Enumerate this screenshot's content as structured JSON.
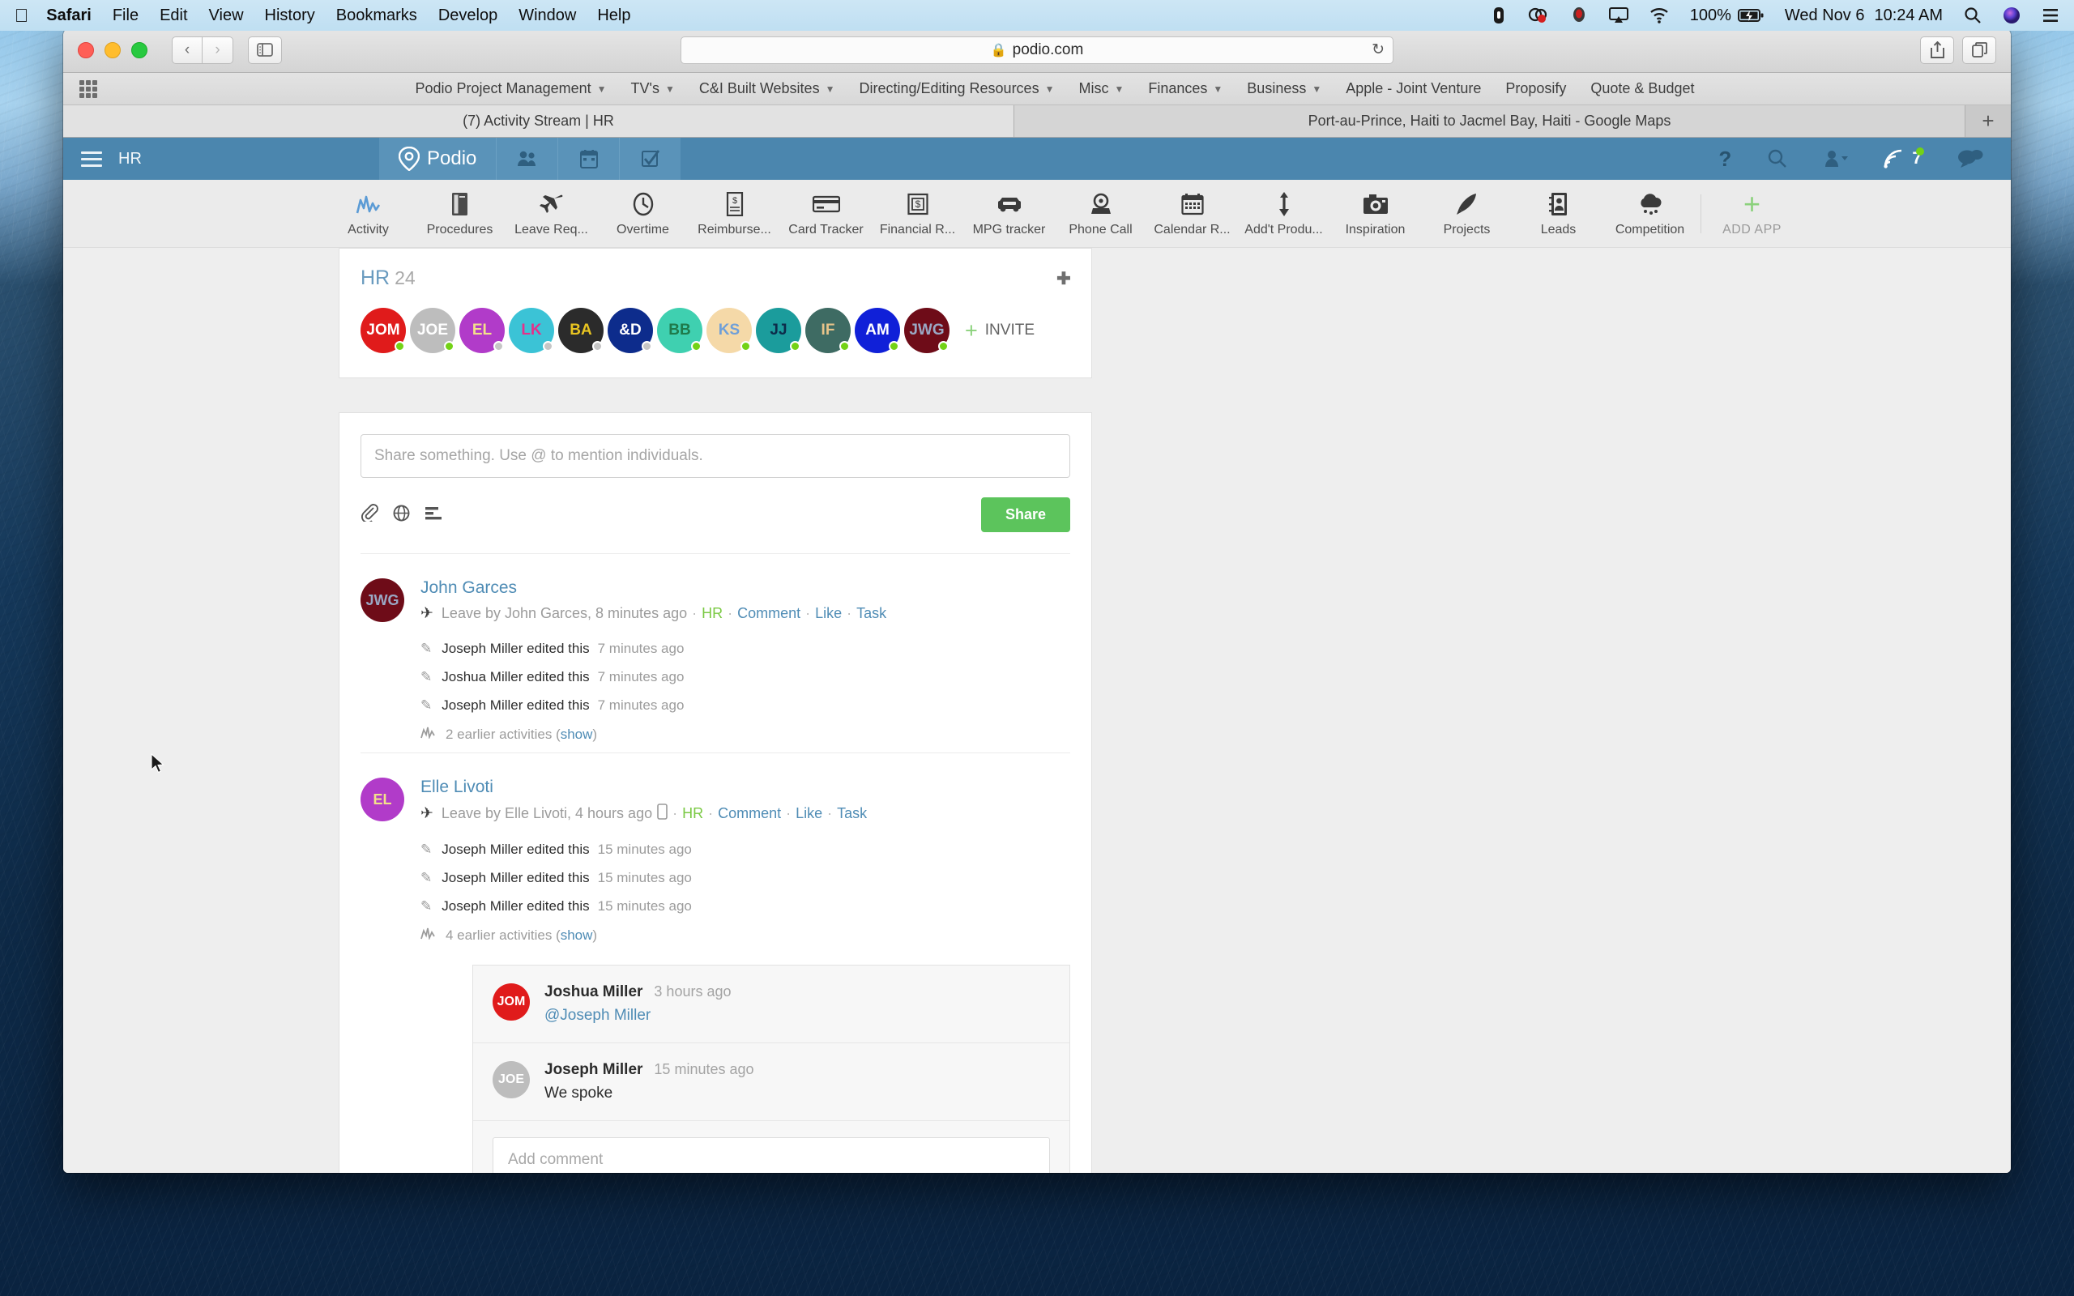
{
  "menubar": {
    "apple_icon": "apple-logo",
    "items": [
      "Safari",
      "File",
      "Edit",
      "View",
      "History",
      "Bookmarks",
      "Develop",
      "Window",
      "Help"
    ],
    "status": {
      "battery": "100%",
      "date": "Wed Nov 6",
      "time": "10:24 AM"
    }
  },
  "browser": {
    "url": "podio.com",
    "bookmarks": [
      {
        "label": "Podio Project Management",
        "has_menu": true
      },
      {
        "label": "TV's",
        "has_menu": true
      },
      {
        "label": "C&I Built Websites",
        "has_menu": true
      },
      {
        "label": "Directing/Editing Resources",
        "has_menu": true
      },
      {
        "label": "Misc",
        "has_menu": true
      },
      {
        "label": "Finances",
        "has_menu": true
      },
      {
        "label": "Business",
        "has_menu": true
      },
      {
        "label": "Apple - Joint Venture",
        "has_menu": false
      },
      {
        "label": "Proposify",
        "has_menu": false
      },
      {
        "label": "Quote & Budget",
        "has_menu": false
      }
    ],
    "tabs": [
      {
        "title": "(7) Activity Stream | HR",
        "active": true
      },
      {
        "title": "Port-au-Prince, Haiti to Jacmel Bay, Haiti - Google Maps",
        "active": false
      }
    ],
    "new_tab_label": "+"
  },
  "podio_header": {
    "workspace": "HR",
    "brand": "Podio",
    "notification_count": "7",
    "accent": "#4b86ae"
  },
  "apps": [
    {
      "label": "Activity",
      "icon": "activity-chart-icon",
      "active": true
    },
    {
      "label": "Procedures",
      "icon": "book-icon",
      "active": false
    },
    {
      "label": "Leave Req...",
      "icon": "plane-icon",
      "active": false
    },
    {
      "label": "Overtime",
      "icon": "clock-icon",
      "active": false
    },
    {
      "label": "Reimburse...",
      "icon": "receipt-icon",
      "active": false
    },
    {
      "label": "Card Tracker",
      "icon": "credit-card-icon",
      "active": false
    },
    {
      "label": "Financial R...",
      "icon": "money-doc-icon",
      "active": false
    },
    {
      "label": "MPG tracker",
      "icon": "car-icon",
      "active": false
    },
    {
      "label": "Phone Call",
      "icon": "telephone-icon",
      "active": false
    },
    {
      "label": "Calendar R...",
      "icon": "calendar-icon",
      "active": false
    },
    {
      "label": "Add't Produ...",
      "icon": "up-down-arrows-icon",
      "active": false
    },
    {
      "label": "Inspiration",
      "icon": "camera-icon",
      "active": false
    },
    {
      "label": "Projects",
      "icon": "rocket-icon",
      "active": false
    },
    {
      "label": "Leads",
      "icon": "address-book-icon",
      "active": false
    },
    {
      "label": "Competition",
      "icon": "cloud-snow-icon",
      "active": false
    }
  ],
  "add_app": {
    "label": "ADD APP",
    "icon": "plus-icon",
    "color": "#8bd17c"
  },
  "workspace": {
    "title": "HR",
    "member_count": "24",
    "invite_label": "INVITE",
    "members": [
      {
        "initials": "JOM",
        "bg": "#e01b1b",
        "fg": "#ffffff",
        "status": "#73d216"
      },
      {
        "initials": "JOE",
        "bg": "#bdbdbd",
        "fg": "#ffffff",
        "status": "#73d216"
      },
      {
        "initials": "EL",
        "bg": "#b13bc9",
        "fg": "#f3e08a",
        "status": "#c6c6c6"
      },
      {
        "initials": "LK",
        "bg": "#3bc3d6",
        "fg": "#e6308a",
        "status": "#c6c6c6"
      },
      {
        "initials": "BA",
        "bg": "#2b2b2b",
        "fg": "#e8c421",
        "status": "#c6c6c6"
      },
      {
        "initials": "&D",
        "bg": "#0d2c8c",
        "fg": "#ffffff",
        "status": "#c6c6c6"
      },
      {
        "initials": "BB",
        "bg": "#3fd0b0",
        "fg": "#1f7a4a",
        "status": "#73d216"
      },
      {
        "initials": "KS",
        "bg": "#f5d9a8",
        "fg": "#6f9fd8",
        "status": "#73d216"
      },
      {
        "initials": "JJ",
        "bg": "#1b9c9c",
        "fg": "#0d2c4a",
        "status": "#73d216"
      },
      {
        "initials": "IF",
        "bg": "#3e6b63",
        "fg": "#e8c48a",
        "status": "#73d216"
      },
      {
        "initials": "AM",
        "bg": "#1020d8",
        "fg": "#ffffff",
        "status": "#73d216"
      },
      {
        "initials": "JWG",
        "bg": "#6e0c18",
        "fg": "#9aa8c4",
        "status": "#73d216"
      }
    ]
  },
  "share": {
    "placeholder": "Share something. Use @ to mention individuals.",
    "button_label": "Share",
    "icons": [
      "attachment-icon",
      "globe-icon",
      "poll-icon"
    ],
    "button_color": "#5cc45c"
  },
  "posts": [
    {
      "author": "John Garces",
      "avatar": {
        "initials": "JWG",
        "bg": "#6e0c18",
        "fg": "#9aa8c4"
      },
      "meta_prefix": "Leave by John Garces, 8 minutes ago",
      "has_mobile_icon": false,
      "space_tag": "HR",
      "actions": [
        "Comment",
        "Like",
        "Task"
      ],
      "activities": [
        {
          "who": "Joseph Miller edited this",
          "when": "7 minutes ago"
        },
        {
          "who": "Joshua Miller edited this",
          "when": "7 minutes ago"
        },
        {
          "who": "Joseph Miller edited this",
          "when": "7 minutes ago"
        }
      ],
      "earlier_text": "2 earlier activities (",
      "earlier_link": "show",
      "earlier_close": ")",
      "comments": []
    },
    {
      "author": "Elle Livoti",
      "avatar": {
        "initials": "EL",
        "bg": "#b13bc9",
        "fg": "#f3e08a"
      },
      "meta_prefix": "Leave by Elle Livoti, 4 hours ago",
      "has_mobile_icon": true,
      "space_tag": "HR",
      "actions": [
        "Comment",
        "Like",
        "Task"
      ],
      "activities": [
        {
          "who": "Joseph Miller edited this",
          "when": "15 minutes ago"
        },
        {
          "who": "Joseph Miller edited this",
          "when": "15 minutes ago"
        },
        {
          "who": "Joseph Miller edited this",
          "when": "15 minutes ago"
        }
      ],
      "earlier_text": "4 earlier activities (",
      "earlier_link": "show",
      "earlier_close": ")",
      "comments": [
        {
          "author": "Joshua Miller",
          "time": "3 hours ago",
          "text": "@Joseph Miller",
          "is_mention": true,
          "avatar": {
            "initials": "JOM",
            "bg": "#e01b1b",
            "fg": "#ffffff"
          }
        },
        {
          "author": "Joseph Miller",
          "time": "15 minutes ago",
          "text": "We spoke",
          "is_mention": false,
          "avatar": {
            "initials": "JOE",
            "bg": "#bdbdbd",
            "fg": "#ffffff"
          }
        }
      ],
      "comment_placeholder": "Add comment"
    }
  ]
}
